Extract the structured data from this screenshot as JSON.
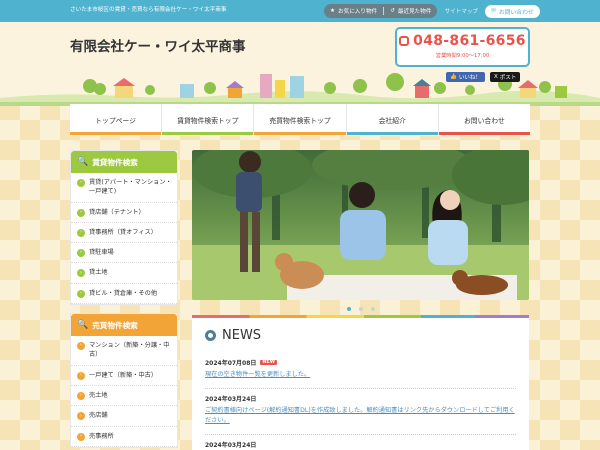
{
  "topbar": {
    "tagline": "さいたま市桜区の賃貸・売買なら有限会社ケー・ワイ太平商事",
    "favorites_label": "お気に入り物件",
    "recent_label": "最近見た物件",
    "sitemap_label": "サイトマップ",
    "contact_label": "お問い合わせ"
  },
  "header": {
    "company": "有限会社ケー・ワイ太平商事",
    "phone": "048-861-6656",
    "hours": "営業時間9:00～17:00",
    "fb_label": "いいね！",
    "tw_label": "ポスト"
  },
  "nav": [
    {
      "label": "トップページ",
      "color": "#f2a436"
    },
    {
      "label": "賃貸物件検索トップ",
      "color": "#9cc93f"
    },
    {
      "label": "売買物件検索トップ",
      "color": "#f2a436"
    },
    {
      "label": "会社紹介",
      "color": "#4fb3cf"
    },
    {
      "label": "お問い合わせ",
      "color": "#e8534a"
    }
  ],
  "sidebar": {
    "rental": {
      "title": "賃貸物件検索",
      "items": [
        "賃貸(アパート・マンション・一戸建て)",
        "貸店舗（テナント）",
        "貸事務所（貸オフィス）",
        "貸駐車場",
        "貸土地",
        "貸ビル・貸倉庫・その他"
      ]
    },
    "sale": {
      "title": "売買物件検索",
      "items": [
        "マンション（新築・分譲・中古）",
        "一戸建て（新築・中古）",
        "売土地",
        "売店舗",
        "売事務所"
      ]
    }
  },
  "slider": {
    "dot_count": 3,
    "active_index": 0
  },
  "news": {
    "title": "NEWS",
    "new_badge": "NEW",
    "items": [
      {
        "date": "2024年07月08日",
        "text": "現在の空き物件一覧を更新しました。",
        "is_new": true
      },
      {
        "date": "2024年03月24日",
        "text": "ご契約書様向けページ(解約通知書DL)を作成致しました。解約通知書はリンク先からダウンロードしてご利用ください。",
        "is_new": false
      },
      {
        "date": "2024年03月24日",
        "text": "",
        "is_new": false
      }
    ]
  }
}
